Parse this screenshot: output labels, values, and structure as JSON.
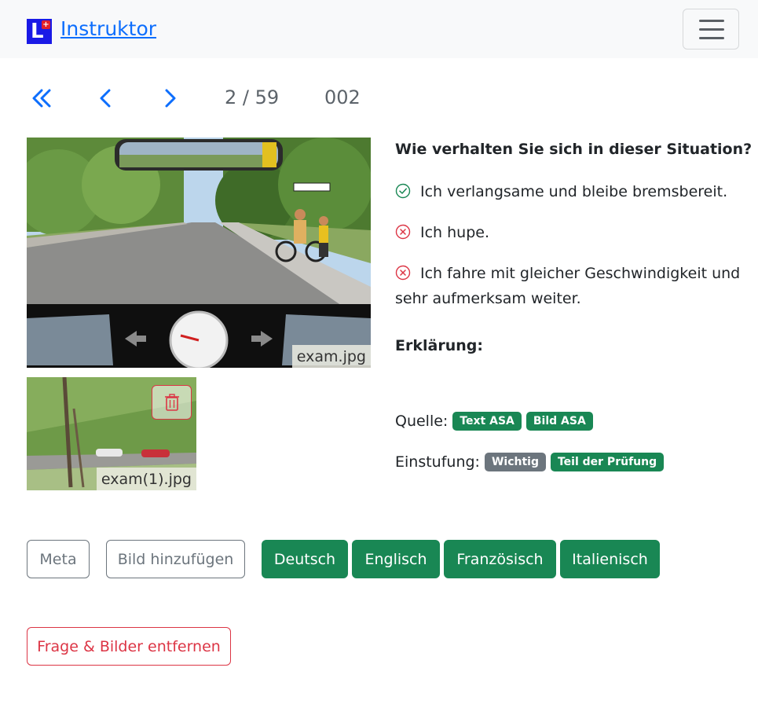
{
  "navbar": {
    "brand_letter": "L",
    "brand_plus": "+",
    "brand_name": "Instruktor"
  },
  "pager": {
    "position": "2 / 59",
    "question_number": "002"
  },
  "images": [
    {
      "caption": "exam.jpg"
    },
    {
      "caption": "exam(1).jpg"
    }
  ],
  "question": {
    "text": "Wie verhalten Sie sich in dieser Situation?",
    "answers": [
      {
        "text": "Ich verlangsame und bleibe bremsbereit.",
        "correct": true
      },
      {
        "text": "Ich hupe.",
        "correct": false
      },
      {
        "text": "Ich fahre mit gleicher Geschwindigkeit und sehr aufmerksam weiter.",
        "correct": false
      }
    ],
    "explanation_label": "Erklärung:"
  },
  "source": {
    "label": "Quelle:",
    "badges": [
      "Text ASA",
      "Bild ASA"
    ]
  },
  "classification": {
    "label": "Einstufung:",
    "badges": [
      "Wichtig",
      "Teil der Prüfung"
    ]
  },
  "actions": {
    "meta": "Meta",
    "add_image": "Bild hinzufügen",
    "languages": [
      "Deutsch",
      "Englisch",
      "Französisch",
      "Italienisch"
    ],
    "remove": "Frage & Bilder entfernen"
  },
  "colors": {
    "primary": "#0d6efd",
    "success": "#198754",
    "danger": "#dc3545",
    "secondary": "#6c757d"
  }
}
